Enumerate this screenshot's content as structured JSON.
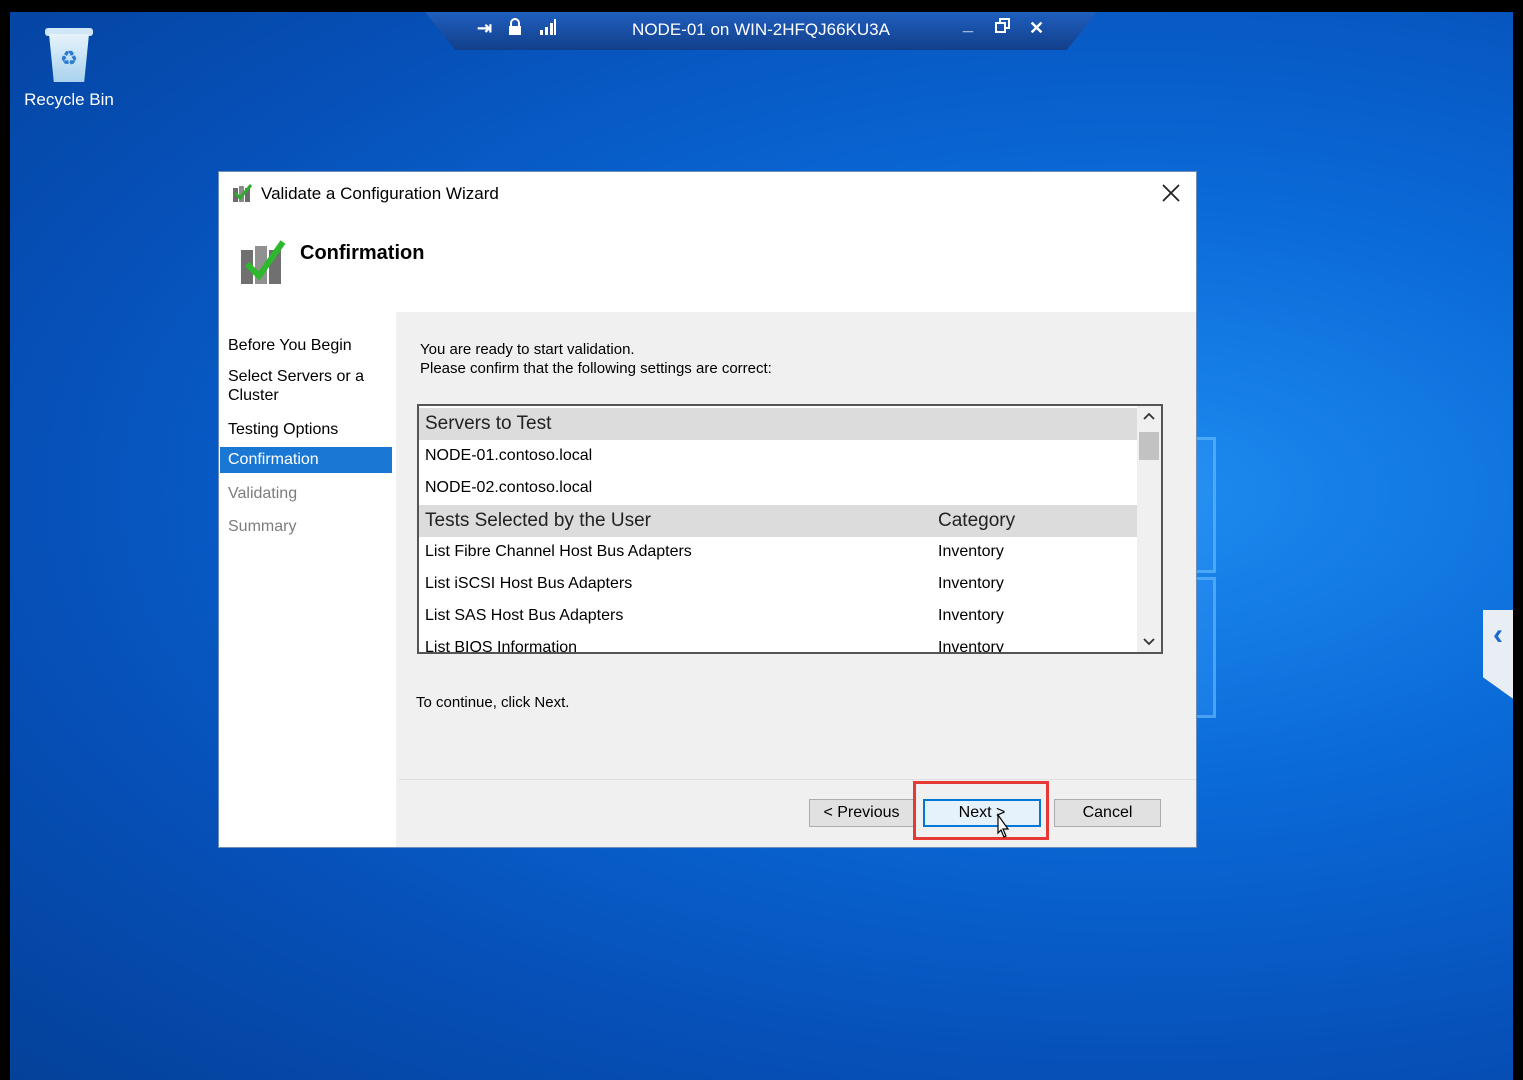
{
  "desktop": {
    "recycle_bin_label": "Recycle Bin"
  },
  "rdp_bar": {
    "title": "NODE-01 on WIN-2HFQJ66KU3A",
    "icons": [
      "pin-icon",
      "lock-icon",
      "signal-icon",
      "minimize-icon",
      "restore-icon",
      "close-icon"
    ]
  },
  "dialog": {
    "title": "Validate a Configuration Wizard",
    "page_title": "Confirmation",
    "nav": [
      {
        "label": "Before You Begin",
        "state": "normal"
      },
      {
        "label": "Select Servers or a Cluster",
        "state": "normal"
      },
      {
        "label": "Testing Options",
        "state": "normal"
      },
      {
        "label": "Confirmation",
        "state": "active"
      },
      {
        "label": "Validating",
        "state": "disabled"
      },
      {
        "label": "Summary",
        "state": "disabled"
      }
    ],
    "intro_line1": "You are ready to start validation.",
    "intro_line2": "Please confirm that the following settings are correct:",
    "servers_header": "Servers to Test",
    "servers": [
      "NODE-01.contoso.local",
      "NODE-02.contoso.local"
    ],
    "tests_header": "Tests Selected by the User",
    "category_header": "Category",
    "tests": [
      {
        "name": "List Fibre Channel Host Bus Adapters",
        "category": "Inventory"
      },
      {
        "name": "List iSCSI Host Bus Adapters",
        "category": "Inventory"
      },
      {
        "name": "List SAS Host Bus Adapters",
        "category": "Inventory"
      },
      {
        "name": "List BIOS Information",
        "category": "Inventory"
      }
    ],
    "continue_text": "To continue, click Next.",
    "buttons": {
      "previous": "< Previous",
      "next": "Next >",
      "cancel": "Cancel"
    }
  },
  "colors": {
    "accent": "#1a78d4",
    "highlight": "#e53935"
  }
}
